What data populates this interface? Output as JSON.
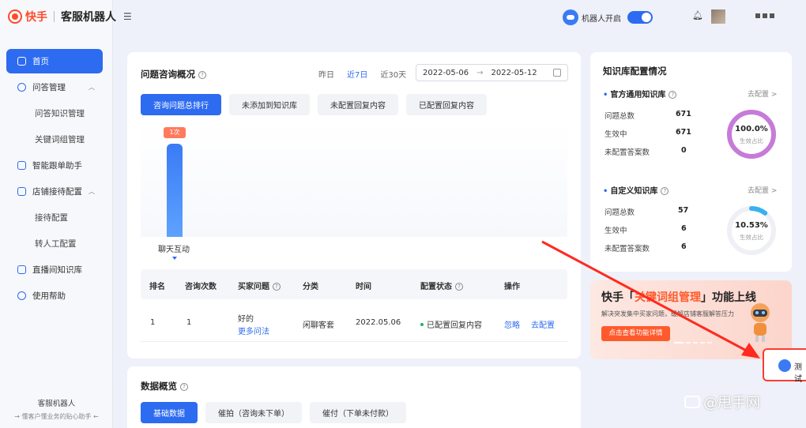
{
  "app": {
    "brand": "快手",
    "name": "客服机器人"
  },
  "sidebar": {
    "items": [
      {
        "label": "首页",
        "active": true
      },
      {
        "label": "问答管理",
        "expanded": true
      },
      {
        "label": "问答知识管理",
        "sub": true
      },
      {
        "label": "关键词组管理",
        "sub": true
      },
      {
        "label": "智能跟单助手"
      },
      {
        "label": "店铺接待配置",
        "expanded": true
      },
      {
        "label": "接待配置",
        "sub": true
      },
      {
        "label": "转人工配置",
        "sub": true
      },
      {
        "label": "直播间知识库"
      },
      {
        "label": "使用帮助"
      }
    ],
    "footer_title": "客服机器人",
    "footer_sub": "→ 懂客户懂业务的贴心助手 ←"
  },
  "topbar": {
    "robot_label": "机器人开启",
    "robot_on": true
  },
  "consult": {
    "title": "问题咨询概况",
    "ranges": [
      "昨日",
      "近7日",
      "近30天"
    ],
    "active_range": "近7日",
    "date_start": "2022-05-06",
    "date_sep": "→",
    "date_end": "2022-05-12",
    "tabs": [
      "咨询问题总排行",
      "未添加到知识库",
      "未配置回复内容",
      "已配置回复内容"
    ]
  },
  "chart_data": {
    "type": "bar",
    "categories": [
      "聊天互动"
    ],
    "values": [
      1
    ],
    "data_labels": [
      "1次"
    ]
  },
  "table": {
    "headers": [
      "排名",
      "咨询次数",
      "买家问题",
      "分类",
      "时间",
      "配置状态",
      "操作"
    ],
    "rows": [
      {
        "rank": "1",
        "count": "1",
        "question": "好的",
        "more": "更多问法",
        "category": "闲聊客套",
        "time": "2022.05.06",
        "status": "已配置回复内容",
        "op1": "忽略",
        "op2": "去配置"
      }
    ]
  },
  "overview": {
    "title": "数据概览",
    "tabs": [
      "基础数据",
      "催拍（咨询未下单）",
      "催付（下单未付款）"
    ]
  },
  "kb": {
    "title": "知识库配置情况",
    "official": {
      "title": "官方通用知识库",
      "go": "去配置 >",
      "total_label": "问题总数",
      "total": "671",
      "active_label": "生效中",
      "active": "671",
      "unset_label": "未配置答案数",
      "unset": "0",
      "pct": "100.0%",
      "pct_label": "生效占比",
      "ratio": 1.0
    },
    "custom": {
      "title": "自定义知识库",
      "go": "去配置 >",
      "total_label": "问题总数",
      "total": "57",
      "active_label": "生效中",
      "active": "6",
      "unset_label": "未配置答案数",
      "unset": "6",
      "pct": "10.53%",
      "pct_label": "生效占比",
      "ratio": 0.1053
    }
  },
  "banner": {
    "title_pre": "快手「",
    "title_hl": "关键词组管理",
    "title_post": "」功能上线",
    "sub": "解决突发集中买家问题，缓解店铺客服解答压力",
    "button": "点击查看功能详情"
  },
  "test_btn": {
    "label": "测试"
  },
  "watermark": "@甩手网"
}
